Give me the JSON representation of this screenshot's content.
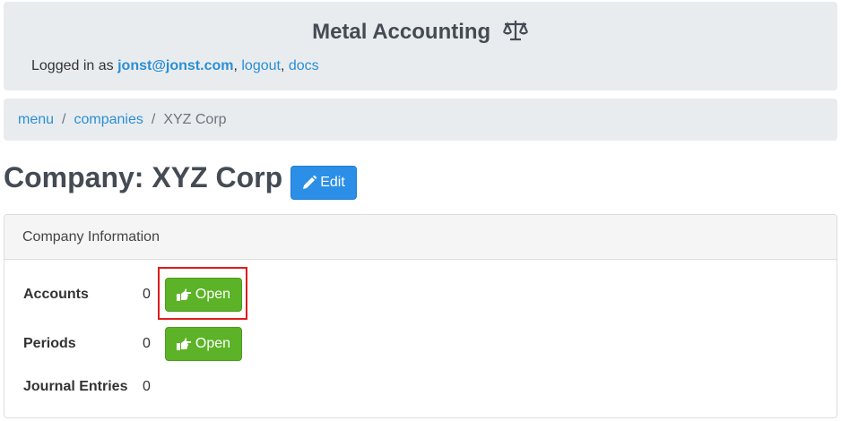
{
  "header": {
    "title": "Metal Accounting",
    "title_icon": "scale-icon",
    "logged_in_prefix": "Logged in as",
    "user_email": "jonst@jonst.com",
    "logout_label": "logout",
    "docs_label": "docs"
  },
  "breadcrumb": {
    "items": [
      "menu",
      "companies"
    ],
    "current": "XYZ Corp"
  },
  "page": {
    "title": "Company: XYZ Corp",
    "edit_label": "Edit"
  },
  "card": {
    "header": "Company Information",
    "rows": [
      {
        "label": "Accounts",
        "count": "0",
        "button": "Open"
      },
      {
        "label": "Periods",
        "count": "0",
        "button": "Open"
      },
      {
        "label": "Journal Entries",
        "count": "0"
      }
    ]
  },
  "colors": {
    "primary": "#2b8fe8",
    "success": "#5cb328",
    "highlight": "#e01b1b",
    "link": "#2a8fd4"
  }
}
